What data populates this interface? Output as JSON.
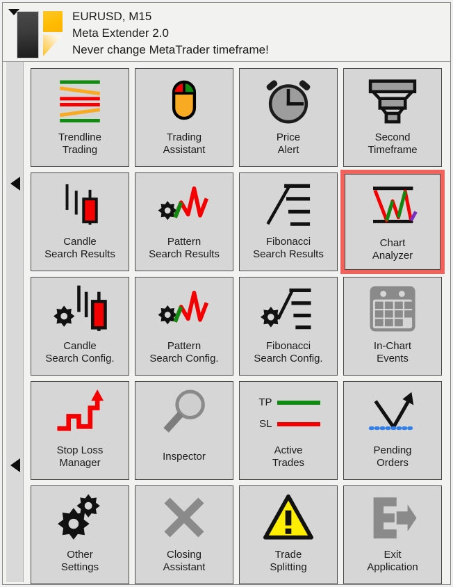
{
  "window": {
    "collapse_arrow_icon": "triangle-down-icon",
    "logo_icon": "meta-extender-logo"
  },
  "header": {
    "line1": "EURUSD, M15",
    "line2": "Meta Extender 2.0",
    "line3": "Never change MetaTrader timeframe!"
  },
  "sidebar": {
    "arrow_top_icon": "triangle-left-icon",
    "arrow_bottom_icon": "triangle-left-icon"
  },
  "colors": {
    "accent_selected": "#f0625c",
    "tile_bg": "#d6d6d6",
    "panel_bg": "#f2f2f0",
    "green": "#118a11",
    "red": "#f40000",
    "orange": "#f8ab22",
    "purple": "#7b2fbe",
    "yellow": "#ffee00",
    "grey_icon": "#8a8a8a",
    "text": "#1b1b1b"
  },
  "grid": {
    "columns": 4,
    "tiles": [
      {
        "id": "trendline-trading",
        "icon": "trendline-lines-icon",
        "label_1": "Trendline",
        "label_2": "Trading",
        "selected": false
      },
      {
        "id": "trading-assistant",
        "icon": "mouse-icon",
        "label_1": "Trading",
        "label_2": "Assistant",
        "selected": false
      },
      {
        "id": "price-alert",
        "icon": "alarm-clock-icon",
        "label_1": "Price",
        "label_2": "Alert",
        "selected": false
      },
      {
        "id": "second-timeframe",
        "icon": "funnel-icon",
        "label_1": "Second",
        "label_2": "Timeframe",
        "selected": false
      },
      {
        "id": "candle-search-results",
        "icon": "candlestick-icon",
        "label_1": "Candle",
        "label_2": "Search Results",
        "selected": false
      },
      {
        "id": "pattern-search-results",
        "icon": "zigzag-gear-icon",
        "label_1": "Pattern",
        "label_2": "Search Results",
        "selected": false
      },
      {
        "id": "fibonacci-search-results",
        "icon": "fibonacci-levels-icon",
        "label_1": "Fibonacci",
        "label_2": "Search Results",
        "selected": false
      },
      {
        "id": "chart-analyzer",
        "icon": "chart-analyzer-icon",
        "label_1": "Chart",
        "label_2": "Analyzer",
        "selected": true
      },
      {
        "id": "candle-search-config",
        "icon": "candlestick-gear-icon",
        "label_1": "Candle",
        "label_2": "Search Config.",
        "selected": false
      },
      {
        "id": "pattern-search-config",
        "icon": "zigzag-gear-icon",
        "label_1": "Pattern",
        "label_2": "Search Config.",
        "selected": false
      },
      {
        "id": "fibonacci-search-config",
        "icon": "fibonacci-levels-gear-icon",
        "label_1": "Fibonacci",
        "label_2": "Search Config.",
        "selected": false
      },
      {
        "id": "in-chart-events",
        "icon": "calendar-icon",
        "label_1": "In-Chart",
        "label_2": "Events",
        "selected": false
      },
      {
        "id": "stop-loss-manager",
        "icon": "staircase-arrow-icon",
        "label_1": "Stop Loss",
        "label_2": "Manager",
        "selected": false
      },
      {
        "id": "inspector",
        "icon": "magnifier-icon",
        "label_1": "Inspector",
        "label_2": "",
        "selected": false
      },
      {
        "id": "active-trades",
        "icon": "tp-sl-lines-icon",
        "label_1": "Active",
        "label_2": "Trades",
        "selected": false
      },
      {
        "id": "pending-orders",
        "icon": "pending-arrow-icon",
        "label_1": "Pending",
        "label_2": "Orders",
        "selected": false
      },
      {
        "id": "other-settings",
        "icon": "gears-icon",
        "label_1": "Other",
        "label_2": "Settings",
        "selected": false
      },
      {
        "id": "closing-assistant",
        "icon": "cross-icon",
        "label_1": "Closing",
        "label_2": "Assistant",
        "selected": false
      },
      {
        "id": "trade-splitting",
        "icon": "warning-triangle-icon",
        "label_1": "Trade",
        "label_2": "Splitting",
        "selected": false
      },
      {
        "id": "exit-application",
        "icon": "exit-arrow-icon",
        "label_1": "Exit",
        "label_2": "Application",
        "selected": false
      }
    ],
    "active_trades_legend": {
      "tp": "TP",
      "sl": "SL"
    }
  }
}
